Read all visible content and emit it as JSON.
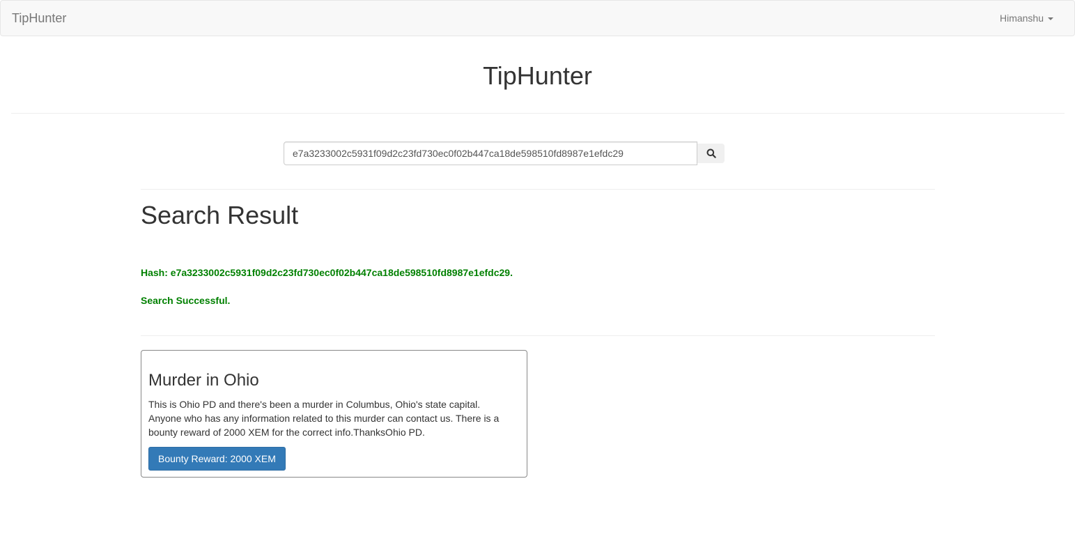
{
  "navbar": {
    "brand": "TipHunter",
    "user_name": "Himanshu"
  },
  "header": {
    "title": "TipHunter"
  },
  "search": {
    "value": "e7a3233002c5931f09d2c23fd730ec0f02b447ca18de598510fd8987e1efdc29",
    "button_icon": "search-icon"
  },
  "result": {
    "title": "Search Result",
    "hash_line": "Hash: e7a3233002c5931f09d2c23fd730ec0f02b447ca18de598510fd8987e1efdc29.",
    "status_line": "Search Successful.",
    "status_color": "#008000"
  },
  "tip_card": {
    "title": "Murder in Ohio",
    "description": "This is Ohio PD and there's been a murder in Columbus, Ohio's state capital. Anyone who has any information related to this murder can contact us. There is a bounty reward of 2000 XEM for the correct info.ThanksOhio PD.",
    "button_label": "Bounty Reward: 2000 XEM",
    "button_color": "#337ab7"
  }
}
